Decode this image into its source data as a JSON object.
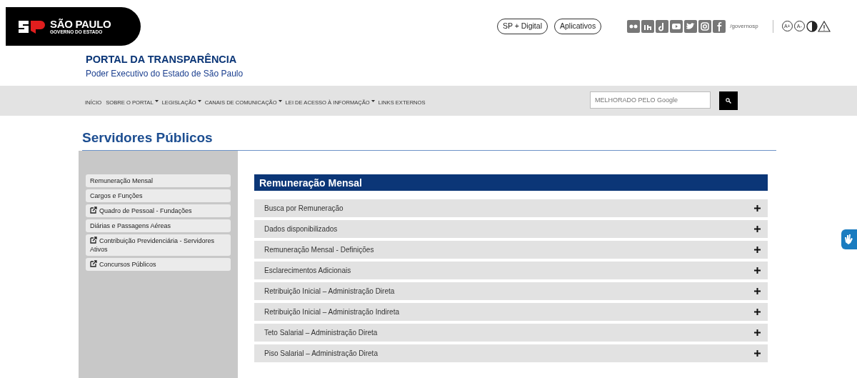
{
  "logo": {
    "title": "SÃO PAULO",
    "subtitle": "GOVERNO DO ESTADO"
  },
  "portal": {
    "title": "PORTAL DA TRANSPARÊNCIA",
    "subtitle": "Poder Executivo do Estado de São Paulo"
  },
  "top_links": [
    "SP + Digital",
    "Aplicativos"
  ],
  "social": {
    "handle": "/governosp"
  },
  "accessibility": [
    "A+",
    "A-"
  ],
  "nav": [
    {
      "label": "INÍCIO",
      "dropdown": false
    },
    {
      "label": "SOBRE O PORTAL",
      "dropdown": true
    },
    {
      "label": "LEGISLAÇÃO",
      "dropdown": true
    },
    {
      "label": "CANAIS DE COMUNICAÇÃO",
      "dropdown": true
    },
    {
      "label": "LEI DE ACESSO À INFORMAÇÃO",
      "dropdown": true
    },
    {
      "label": "LINKS EXTERNOS",
      "dropdown": false
    }
  ],
  "search": {
    "placeholder": "MELHORADO PELO Google"
  },
  "page_title": "Servidores Públicos",
  "sidebar": [
    {
      "label": "Remuneração Mensal",
      "external": false
    },
    {
      "label": "Cargos e Funções",
      "external": false
    },
    {
      "label": "Quadro de Pessoal - Fundações",
      "external": true
    },
    {
      "label": "Diárias e Passagens Aéreas",
      "external": false
    },
    {
      "label": "Contribuição Previdenciária - Servidores Ativos",
      "external": true
    },
    {
      "label": "Concursos Públicos",
      "external": true
    }
  ],
  "section": {
    "title": "Remuneração Mensal",
    "items": [
      {
        "label": "Busca por Remuneração",
        "expanded": false
      },
      {
        "label": "Dados disponibilizados",
        "expanded": false
      },
      {
        "label": "Remuneração Mensal - Definições",
        "expanded": false
      },
      {
        "label": "Esclarecimentos Adicionais",
        "expanded": false
      },
      {
        "label": "Retribuição Inicial – Administração Direta",
        "expanded": false
      },
      {
        "label": "Retribuição Inicial – Administração Indireta",
        "expanded": false
      },
      {
        "label": "Teto Salarial – Administração Direta",
        "expanded": false
      },
      {
        "label": "Piso Salarial – Administração Direta",
        "expanded": false
      }
    ]
  }
}
